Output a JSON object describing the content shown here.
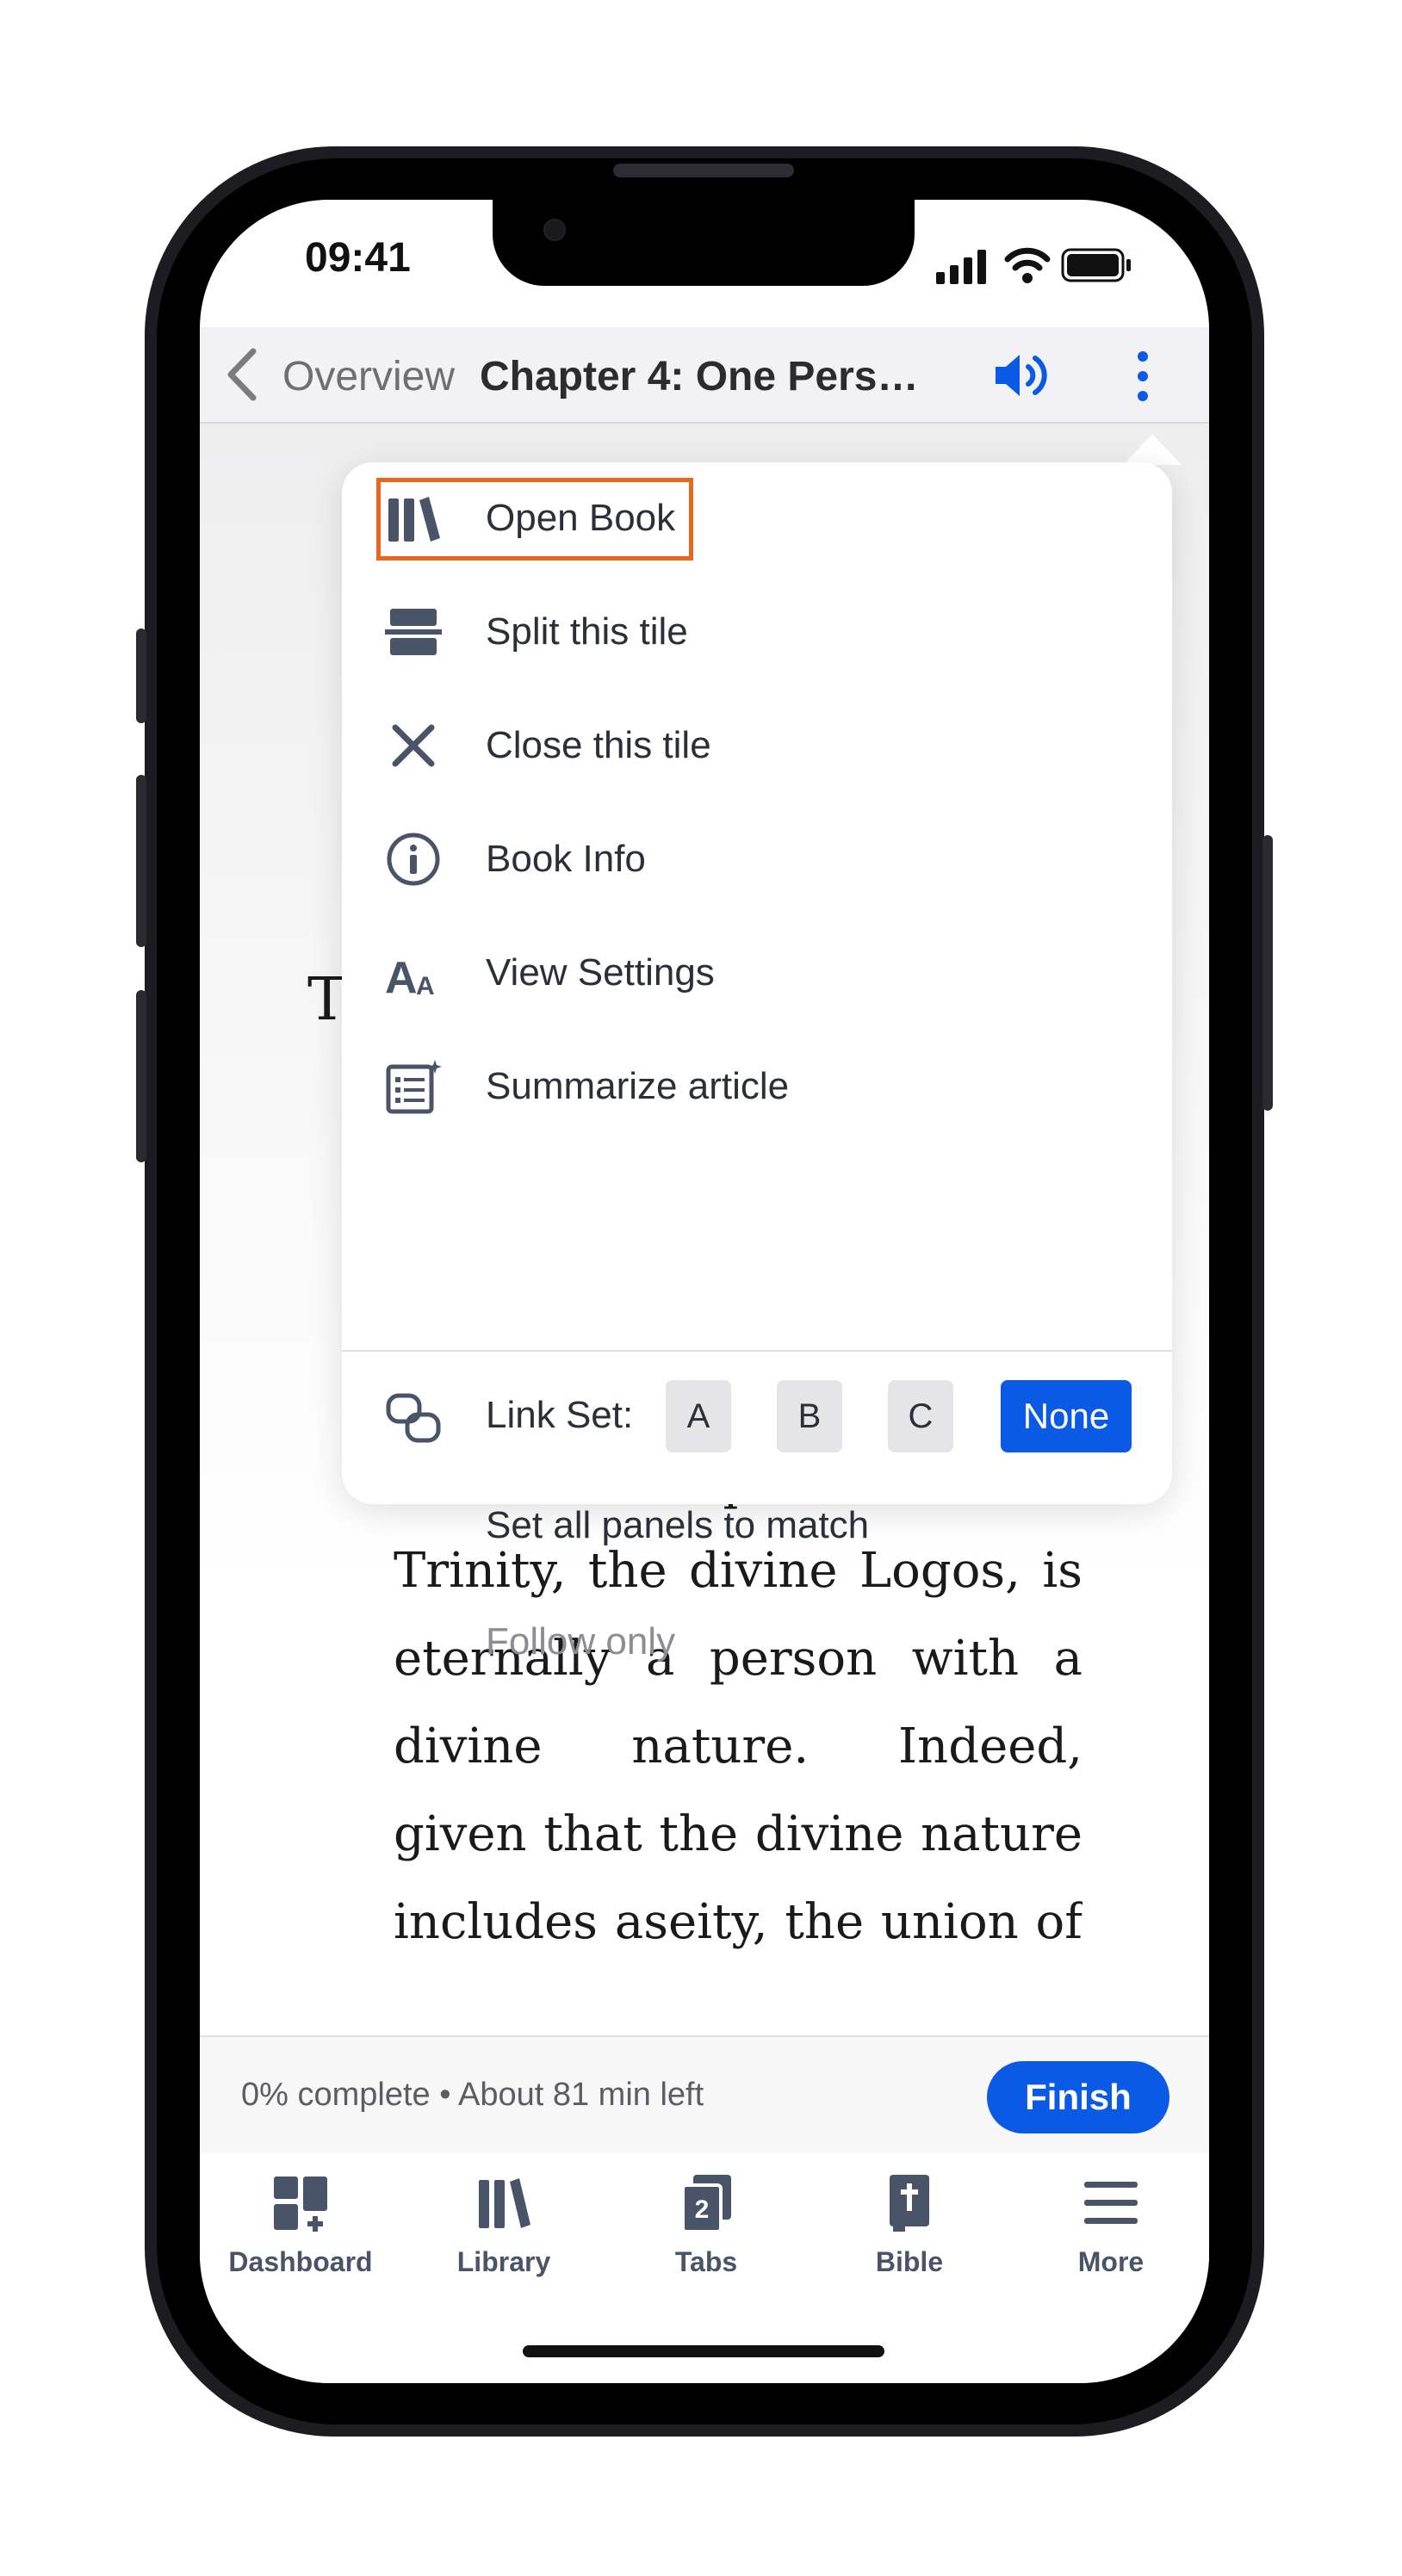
{
  "status": {
    "time": "09:41"
  },
  "nav": {
    "back_label": "Overview",
    "title": "Chapter 4: One Pers…"
  },
  "article": {
    "dropcap": "T",
    "text": "The second person of the Trinity, the divine Logos, is eternally a person with a divine nature. Indeed, given that the divine nature includes aseity, the union of the"
  },
  "menu": {
    "items": [
      {
        "label": "Open Book",
        "icon": "books-icon"
      },
      {
        "label": "Split this tile",
        "icon": "split-icon"
      },
      {
        "label": "Close this tile",
        "icon": "close-icon"
      },
      {
        "label": "Book Info",
        "icon": "info-icon"
      },
      {
        "label": "View Settings",
        "icon": "text-size-icon"
      },
      {
        "label": "Summarize article",
        "icon": "summarize-icon"
      }
    ],
    "link_set": {
      "label": "Link Set:",
      "options": [
        "A",
        "B",
        "C",
        "None"
      ],
      "selected": "None"
    },
    "set_all": "Set all panels to match",
    "follow_only": "Follow only"
  },
  "progress": {
    "text": "0% complete • About 81 min left",
    "finish_label": "Finish"
  },
  "tabs": [
    {
      "label": "Dashboard",
      "icon": "dashboard-icon"
    },
    {
      "label": "Library",
      "icon": "library-icon"
    },
    {
      "label": "Tabs",
      "icon": "tabs-icon",
      "badge": "2"
    },
    {
      "label": "Bible",
      "icon": "bible-icon"
    },
    {
      "label": "More",
      "icon": "menu-icon"
    }
  ],
  "colors": {
    "accent": "#0b5ae6",
    "highlight": "#e8671a",
    "icon": "#4a5468"
  }
}
